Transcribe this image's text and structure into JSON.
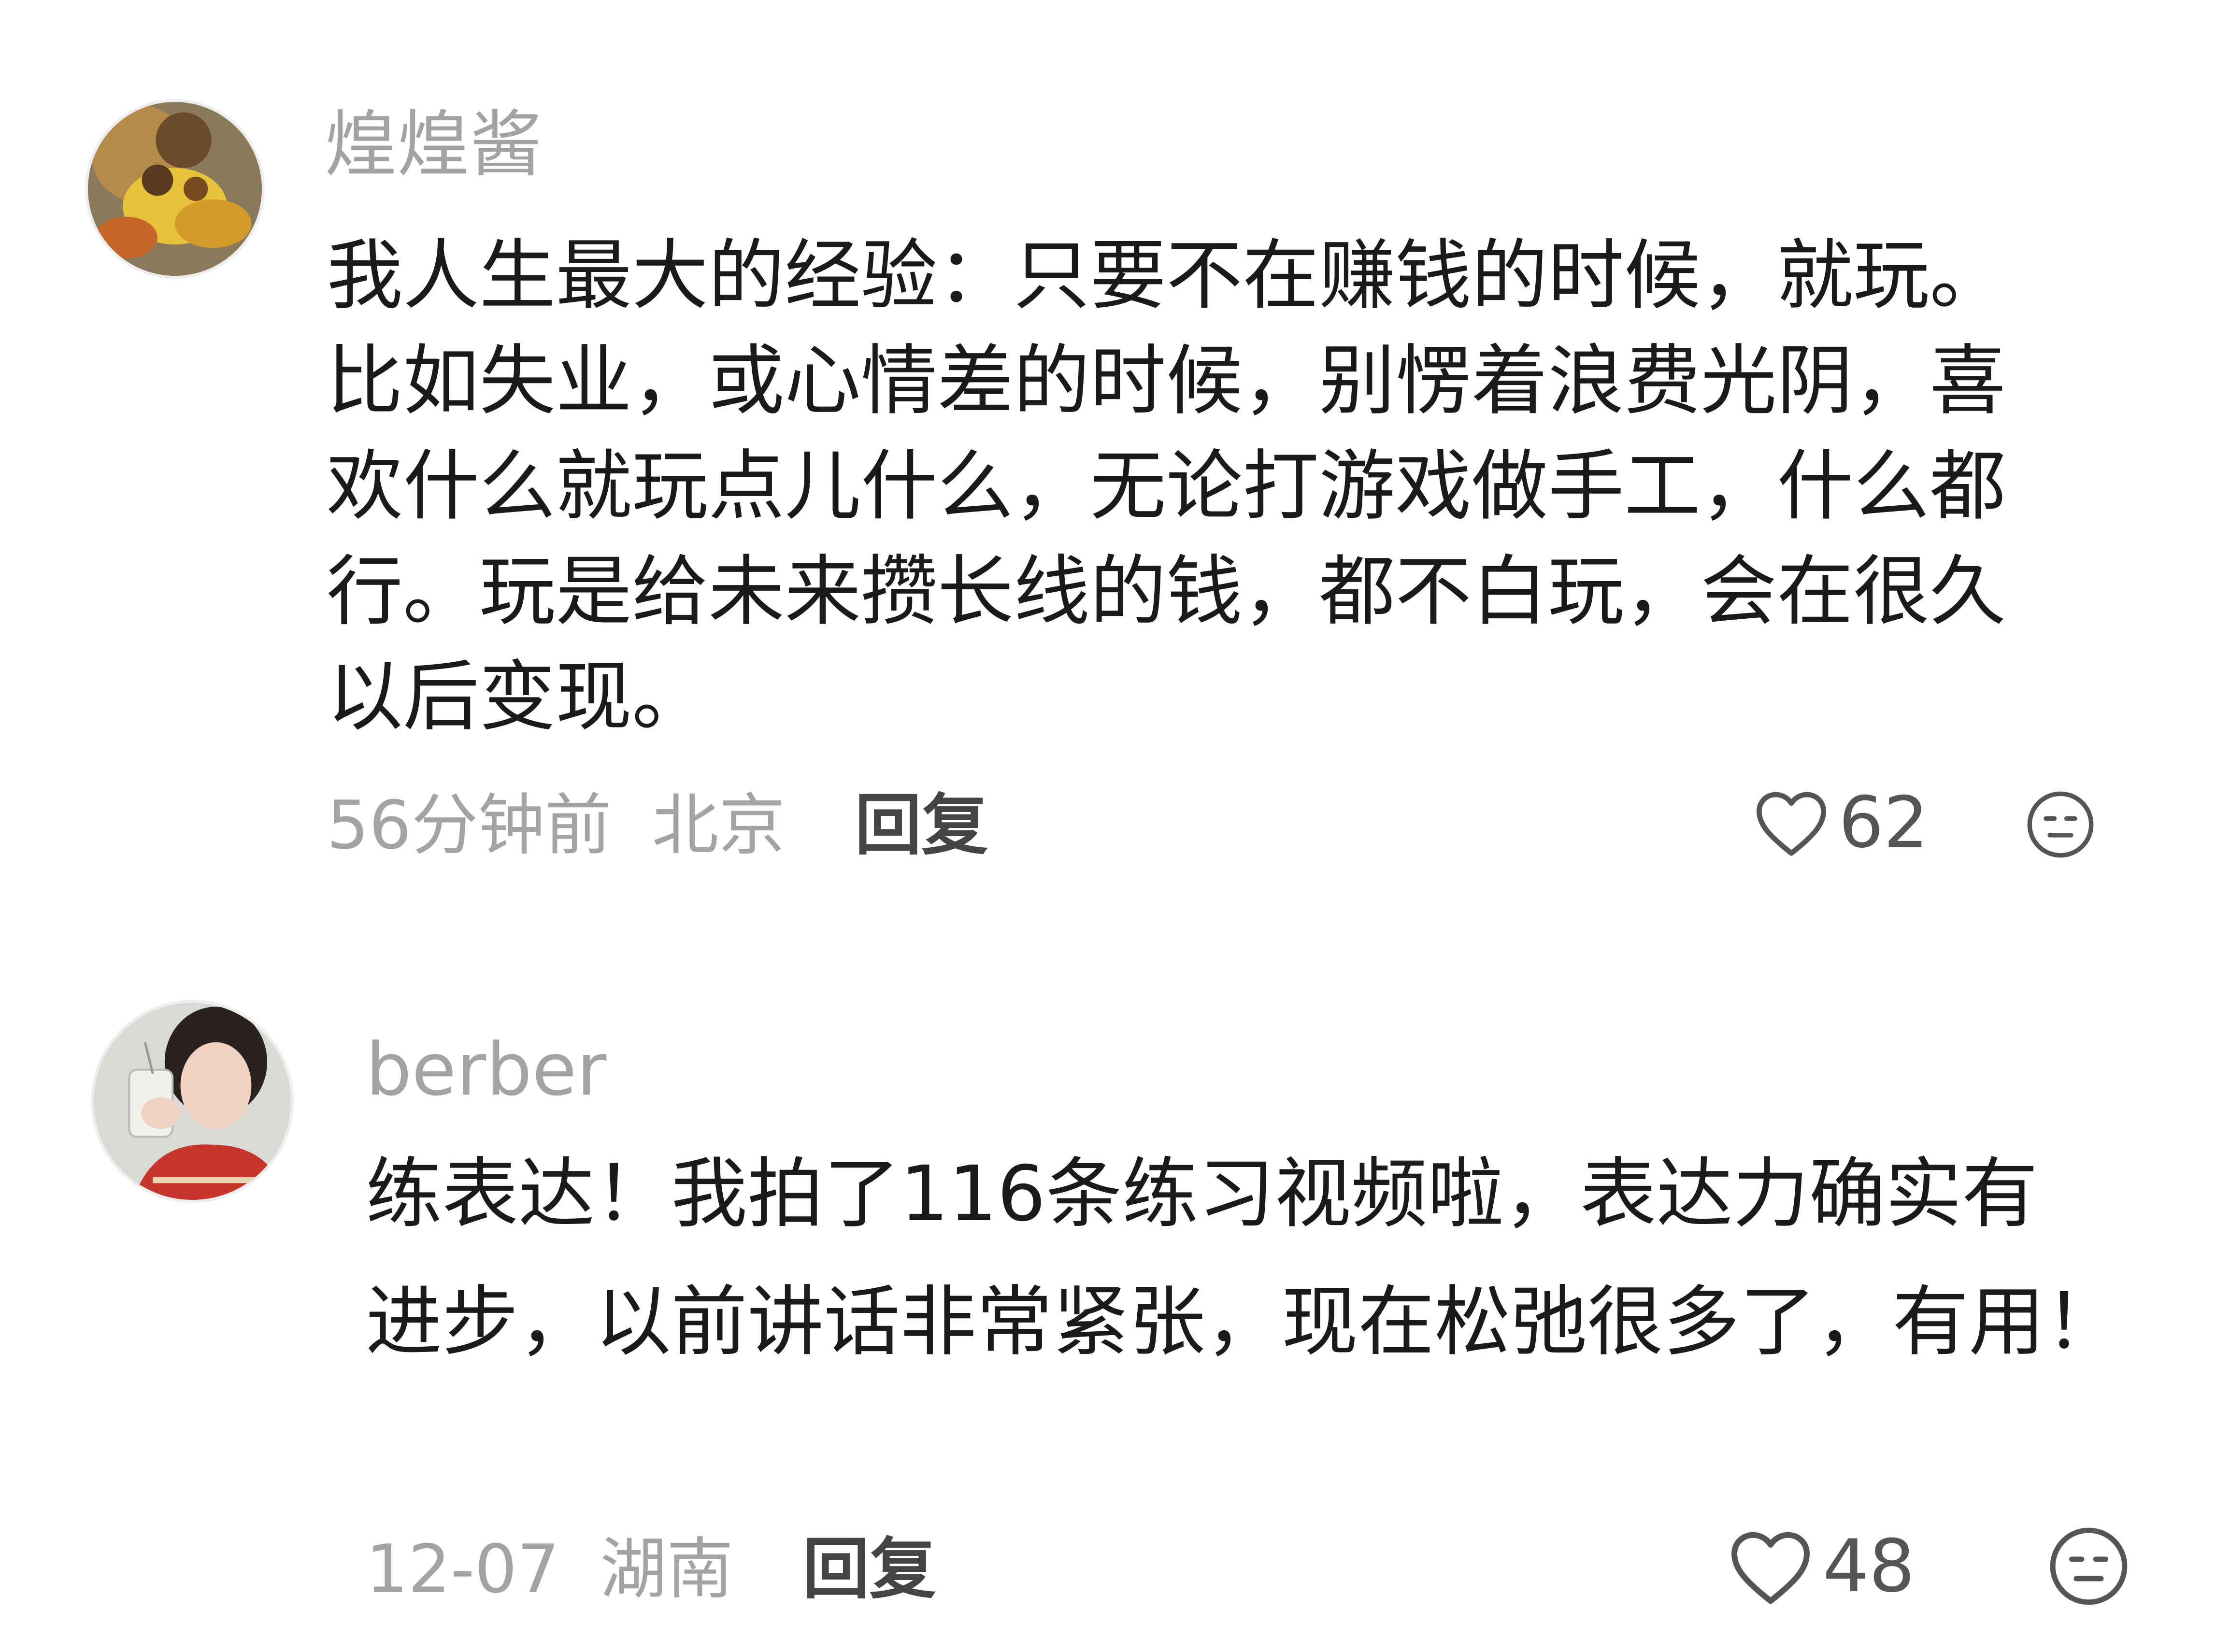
{
  "comments": [
    {
      "username": "煌煌酱",
      "lines": [
        "我人生最大的经验：只要不在赚钱的时候，就玩。",
        "比如失业，或心情差的时候，别愣着浪费光阴，喜",
        "欢什么就玩点儿什么，无论打游戏做手工，什么都",
        "行。玩是给未来攒长线的钱，都不白玩，会在很久",
        "以后变现。"
      ],
      "time": "56分钟前",
      "location": "北京",
      "reply_label": "回复",
      "likes": "62",
      "like_icon": "heart-outline-icon",
      "dislike_icon": "meh-face-icon"
    },
    {
      "username": "berber",
      "lines": [
        "练表达！我拍了116条练习视频啦，表达力确实有",
        "进步，以前讲话非常紧张，现在松弛很多了，有用！"
      ],
      "time": "12-07",
      "location": "湖南",
      "reply_label": "回复",
      "likes": "48",
      "like_icon": "heart-outline-icon",
      "dislike_icon": "meh-face-icon"
    }
  ],
  "colors": {
    "username": "#a3a3a3",
    "content": "#1a1a1a",
    "meta": "#a3a3a3",
    "reply": "#444444",
    "icon": "#555555"
  }
}
